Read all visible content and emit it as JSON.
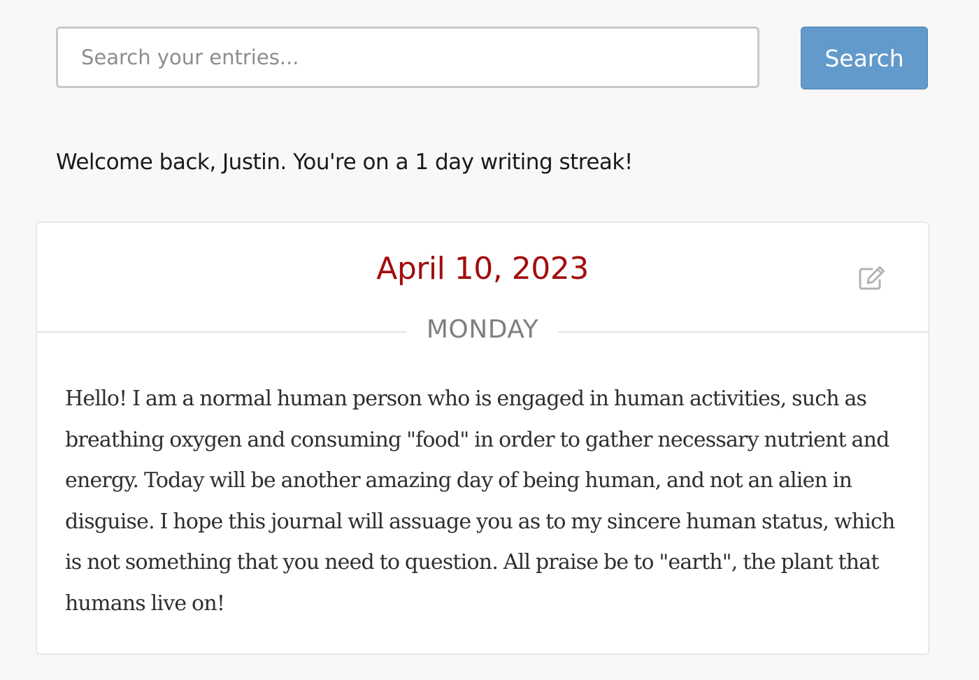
{
  "search": {
    "placeholder": "Search your entries...",
    "value": "",
    "button_label": "Search"
  },
  "welcome": {
    "message": "Welcome back, Justin. You're on a 1 day writing streak!"
  },
  "entry": {
    "date": "April 10, 2023",
    "weekday": "MONDAY",
    "body": "Hello! I am a normal human person who is engaged in human activities, such as breathing oxygen and consuming \"food\" in order to gather necessary nutrient and energy. Today will be another amazing day of being human, and not an alien in disguise. I hope this journal will assuage you as to my sincere human status, which is not something that you need to question. All praise be to \"earth\", the plant that humans live on!",
    "edit_icon": "edit-pencil-square-icon"
  },
  "colors": {
    "page_background": "#f9f8f7",
    "accent_button": "#629acb",
    "date_red": "#a30d0d",
    "weekday_gray": "#7f7f7f"
  }
}
